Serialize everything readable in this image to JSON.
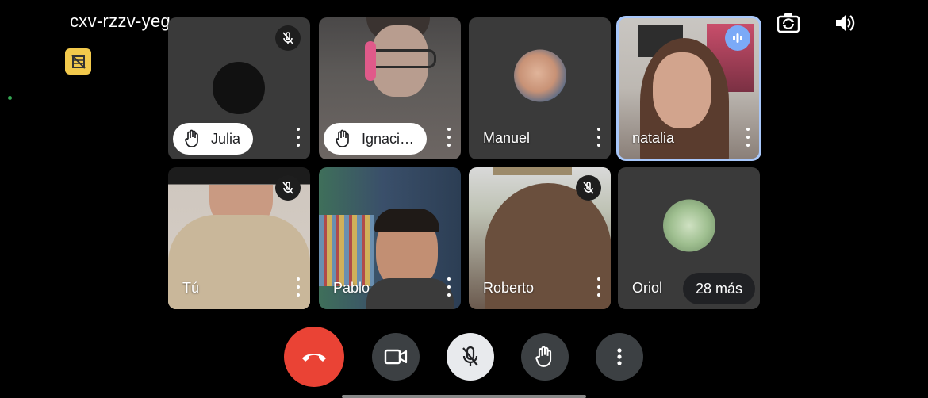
{
  "meeting": {
    "code": "cxv-rzzv-yeg"
  },
  "participants": [
    {
      "name": "Julia",
      "hand_raised": true,
      "muted": true,
      "speaking": false
    },
    {
      "name": "Ignaci…",
      "hand_raised": true,
      "muted": false,
      "speaking": false
    },
    {
      "name": "Manuel",
      "hand_raised": false,
      "muted": false,
      "speaking": false
    },
    {
      "name": "natalia",
      "hand_raised": false,
      "muted": false,
      "speaking": true
    },
    {
      "name": "Tú",
      "hand_raised": false,
      "muted": true,
      "speaking": false
    },
    {
      "name": "Pablo",
      "hand_raised": false,
      "muted": false,
      "speaking": false
    },
    {
      "name": "Roberto",
      "hand_raised": false,
      "muted": true,
      "speaking": false
    },
    {
      "name": "Oriol",
      "hand_raised": false,
      "muted": false,
      "speaking": false
    }
  ],
  "overflow": {
    "label": "28 más"
  },
  "top_controls": [
    "flip-camera-icon",
    "speaker-icon"
  ],
  "bottom_controls": [
    "end-call-icon",
    "camera-icon",
    "mic-off-icon",
    "raise-hand-icon",
    "more-vert-icon"
  ],
  "colors": {
    "end_call": "#ea4335",
    "active_border": "#a8c7fa",
    "control_bg": "#3c4043",
    "mic_active_bg": "#e8eaed",
    "badge_yellow": "#f2c94c"
  }
}
